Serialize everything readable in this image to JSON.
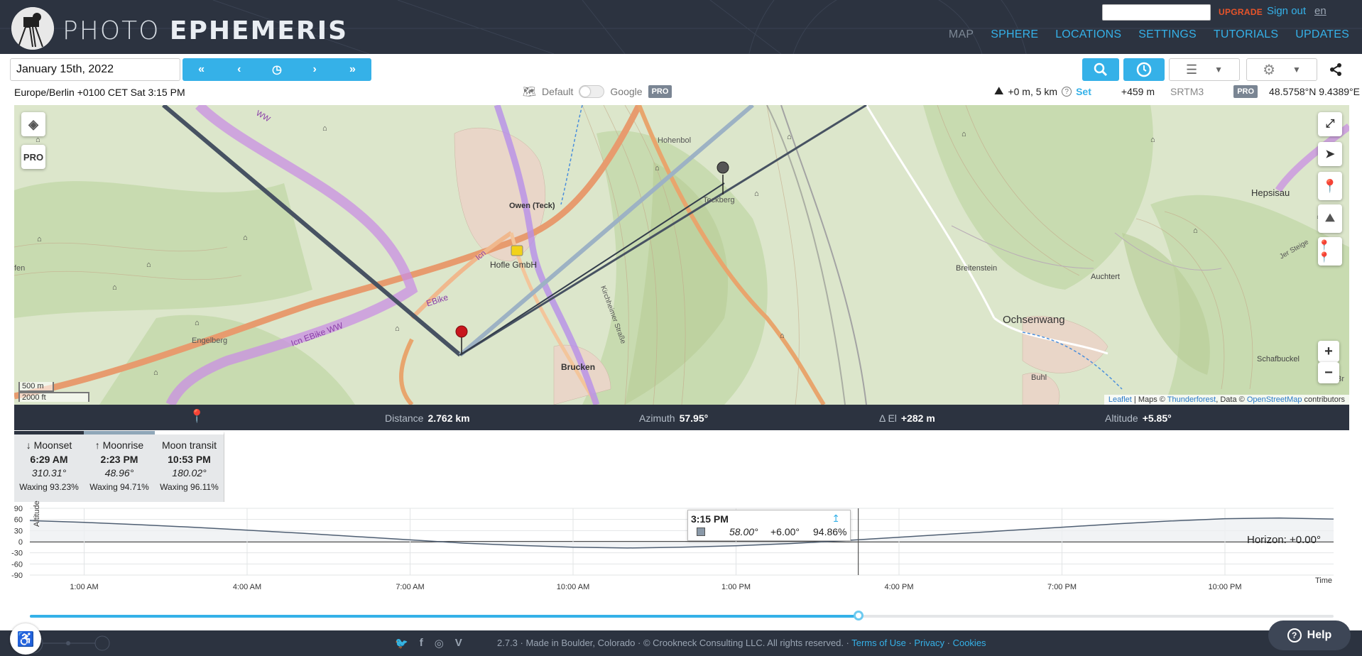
{
  "header": {
    "logo_light": "PHOTO",
    "logo_bold": "EPHEMERIS",
    "upgrade": "UPGRADE",
    "sign_out": "Sign out",
    "language": "en",
    "nav": [
      "MAP",
      "SPHERE",
      "LOCATIONS",
      "SETTINGS",
      "TUTORIALS",
      "UPDATES"
    ]
  },
  "toolbar": {
    "date": "January 15th, 2022",
    "timezone": "Europe/Berlin +0100 CET Sat 3:15 PM",
    "map_default": "Default",
    "map_google": "Google",
    "pro": "PRO",
    "elevation_offset": "+0 m, 5 km",
    "set": "Set",
    "elevation": "+459 m",
    "dem": "SRTM3",
    "coords": "48.5758°N 9.4389°E"
  },
  "map": {
    "labels": {
      "owen": "Owen (Teck)",
      "hofle": "Hofle GmbH",
      "hohenbol": "Hohenbol",
      "teckberg": "Teckberg",
      "engelberg": "Engelberg",
      "brucken": "Brucken",
      "breitenstein": "Breitenstein",
      "auchtert": "Auchtert",
      "ochsenwang": "Ochsenwang",
      "hepsisau": "Hepsisau",
      "buhl": "Buhl",
      "schafbuckel": "Schafbuckel",
      "ebike": "EBike",
      "ebike2": "Icn EBike WW",
      "icn": "Icn",
      "ww": "WW",
      "fen": "fen",
      "br": "Br",
      "kirchheimer": "Kirchheimer Straße",
      "steige": "Jer Steige"
    },
    "scale_m": "500 m",
    "scale_ft": "2000 ft",
    "attribution_leaflet": "Leaflet",
    "attribution_maps": " | Maps © ",
    "attribution_thunderforest": "Thunderforest",
    "attribution_data": ", Data © ",
    "attribution_osm": "OpenStreetMap",
    "attribution_contrib": " contributors",
    "pro_label": "PRO"
  },
  "geodetics": {
    "distance_label": "Distance",
    "distance": "2.762 km",
    "azimuth_label": "Azimuth",
    "azimuth": "57.95°",
    "del_label": "Δ El",
    "del": "+282 m",
    "altitude_label": "Altitude",
    "altitude": "+5.85°"
  },
  "moon_events": [
    {
      "name": "Moonset",
      "arrow": "🡓",
      "time": "6:29 AM",
      "azimuth": "310.31°",
      "phase": "Waxing 93.23%"
    },
    {
      "name": "Moonrise",
      "arrow": "🡑",
      "time": "2:23 PM",
      "azimuth": "48.96°",
      "phase": "Waxing 94.71%"
    },
    {
      "name": "Moon transit",
      "arrow": "",
      "time": "10:53 PM",
      "azimuth": "180.02°",
      "phase": "Waxing 96.11%"
    }
  ],
  "chart_data": {
    "type": "line",
    "ylabel": "Altitude",
    "xlabel": "Time",
    "ylim": [
      -90,
      90
    ],
    "yticks": [
      "90",
      "60",
      "30",
      "0",
      "-30",
      "-60",
      "-90"
    ],
    "xticks": [
      "1:00 AM",
      "4:00 AM",
      "7:00 AM",
      "10:00 AM",
      "1:00 PM",
      "4:00 PM",
      "7:00 PM",
      "10:00 PM"
    ],
    "horizon_label": "Horizon: +0.00°",
    "series": [
      {
        "x": [
          0,
          1,
          2,
          3,
          4,
          5,
          6,
          7,
          8,
          9,
          10,
          11,
          12,
          13,
          14,
          15,
          16,
          17,
          18,
          19,
          20,
          21,
          22,
          23,
          24
        ],
        "values": [
          57,
          52,
          46,
          39,
          31,
          23,
          14,
          5,
          -4,
          -10,
          -15,
          -17,
          -15,
          -11,
          -5,
          3,
          12,
          21,
          30,
          39,
          48,
          56,
          62,
          64,
          61
        ]
      }
    ],
    "tooltip": {
      "time": "3:15 PM",
      "azimuth": "58.00°",
      "altitude": "+6.00°",
      "illumination": "94.86%"
    }
  },
  "footer": {
    "text": "2.7.3 · Made in Boulder, Colorado · © Crookneck Consulting LLC. All rights reserved. · ",
    "terms": "Terms of Use",
    "privacy": "Privacy",
    "cookies": "Cookies",
    "help": "Help"
  },
  "colors": {
    "accent": "#35b1e8",
    "dark": "#2c3340",
    "upgrade": "#e8542a"
  }
}
